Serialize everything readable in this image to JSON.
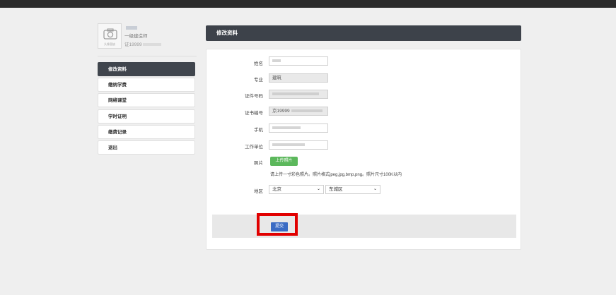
{
  "profile": {
    "title": "一级建造师",
    "cert_prefix": "证19999",
    "avatar_caption": "头像暂缺"
  },
  "sidebar": {
    "items": [
      {
        "label": "修改资料",
        "active": true
      },
      {
        "label": "缴纳学费",
        "active": false
      },
      {
        "label": "网络课堂",
        "active": false
      },
      {
        "label": "学时证明",
        "active": false
      },
      {
        "label": "缴费记录",
        "active": false
      },
      {
        "label": "退出",
        "active": false
      }
    ]
  },
  "panel": {
    "title": "修改资料"
  },
  "form": {
    "name_label": "姓名",
    "major_label": "专业",
    "major_value": "建筑",
    "id_label": "证件号码",
    "cert_label": "证书编号",
    "cert_value": "京19999",
    "phone_label": "手机",
    "company_label": "工作单位",
    "photo_label": "照片",
    "upload_button": "上传照片",
    "photo_hint": "请上传一寸彩色照片。照片格式jpeg,jpg,bmp,png。照片尺寸100K以内",
    "region_label": "地区",
    "province_value": "北京",
    "district_value": "东城区",
    "submit_button": "提交"
  },
  "colors": {
    "header": "#3d424a",
    "upload": "#5cb85c",
    "submit": "#3a6bc4",
    "highlight": "#e10000"
  }
}
